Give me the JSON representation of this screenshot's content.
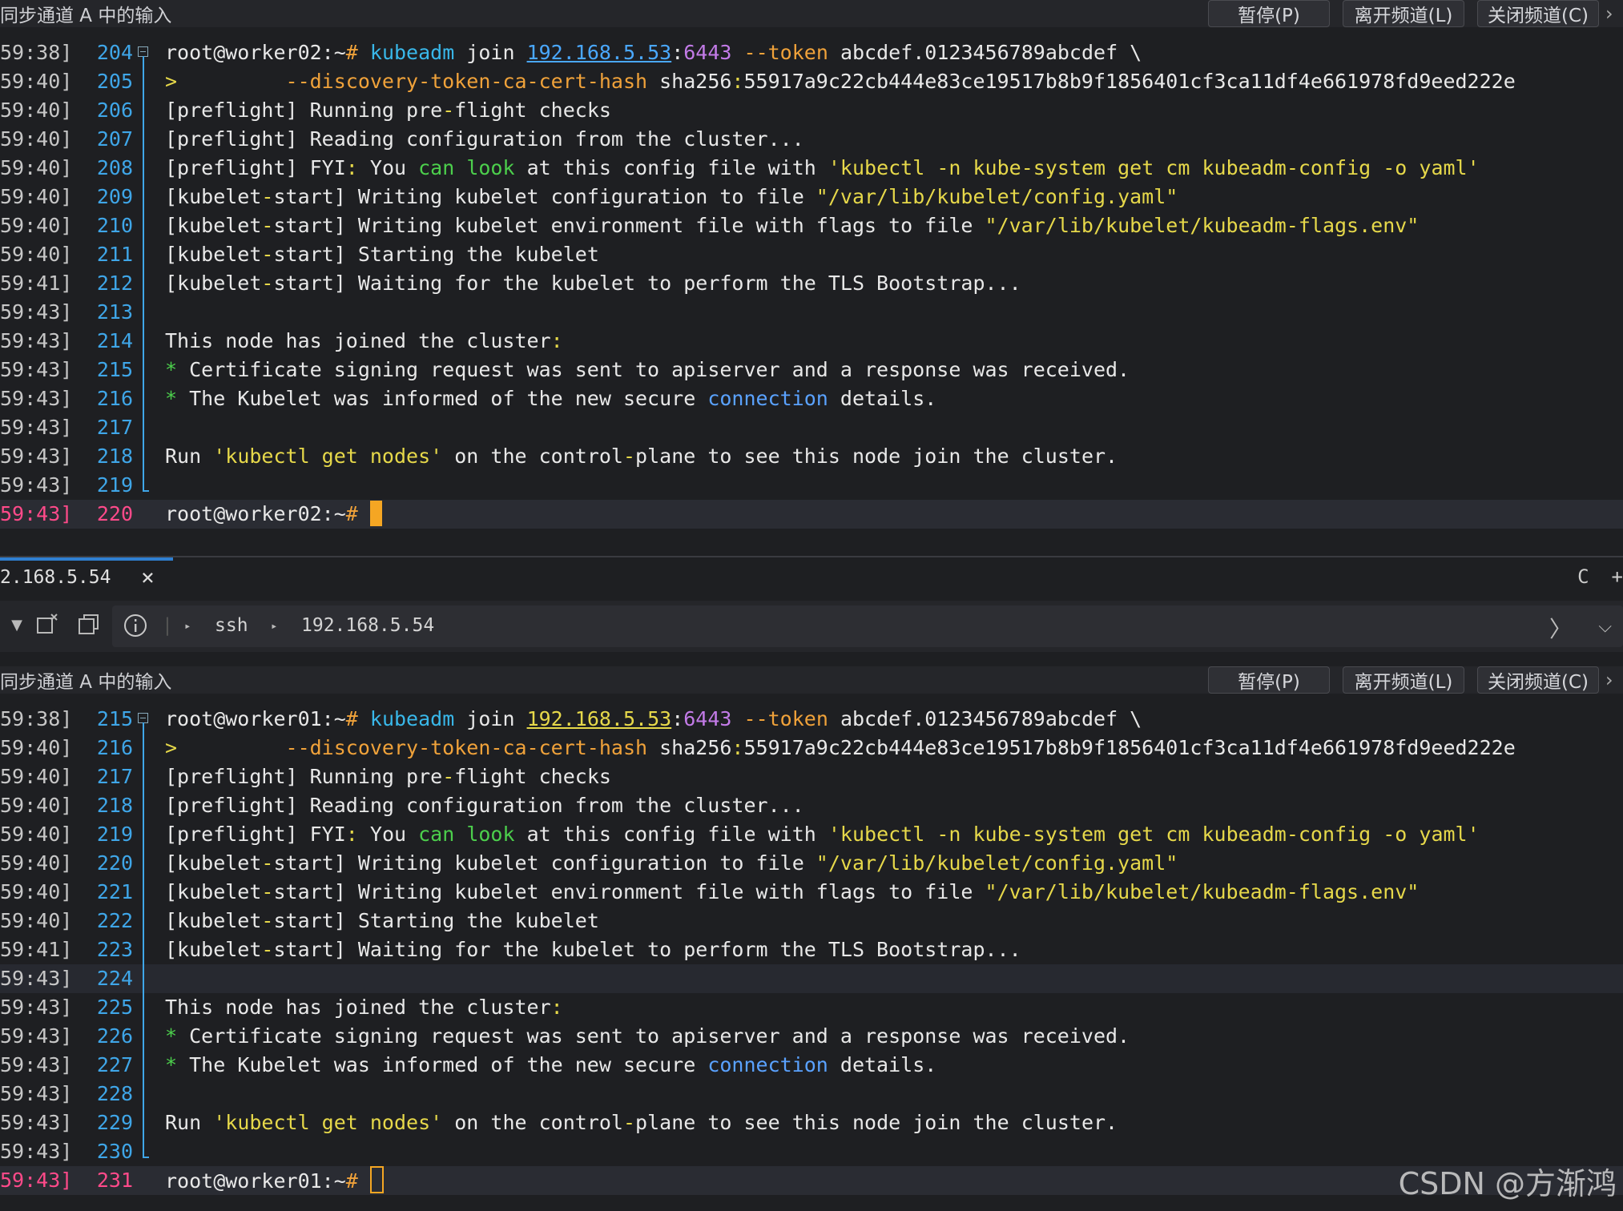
{
  "top_pane": {
    "bar": {
      "title": "同步通道 A 中的输入",
      "pause": "暂停(P)",
      "leave": "离开频道(L)",
      "close": "关闭频道(C)",
      "more": "›"
    },
    "lines": [
      {
        "ts": "59:38]",
        "ln": "204",
        "segs": [
          [
            "root@worker02:~",
            ""
          ],
          [
            "# ",
            "ora"
          ],
          [
            "kubeadm",
            "cyan"
          ],
          [
            " join ",
            ""
          ],
          [
            "192.168.5.53",
            "link"
          ],
          [
            ":",
            ""
          ],
          [
            "6443",
            "pur"
          ],
          [
            " --token",
            "ora"
          ],
          [
            " abcdef.0123456789abcdef \\",
            ""
          ]
        ]
      },
      {
        "ts": "59:40]",
        "ln": "205",
        "segs": [
          [
            "> ",
            "yel"
          ],
          [
            "        --discovery-token-ca-cert-hash",
            "ora"
          ],
          [
            " sha256",
            ""
          ],
          [
            ":",
            "yel"
          ],
          [
            "55917a9c22cb444e83ce19517b8b9f1856401cf3ca11df4e661978fd9eed222e",
            ""
          ]
        ]
      },
      {
        "ts": "59:40]",
        "ln": "206",
        "segs": [
          [
            "[preflight] Running pre",
            ""
          ],
          [
            "-",
            "yel"
          ],
          [
            "flight checks",
            ""
          ]
        ]
      },
      {
        "ts": "59:40]",
        "ln": "207",
        "segs": [
          [
            "[preflight] Reading configuration from the cluster...",
            ""
          ]
        ]
      },
      {
        "ts": "59:40]",
        "ln": "208",
        "segs": [
          [
            "[preflight] FYI",
            ""
          ],
          [
            ":",
            "yel"
          ],
          [
            " You ",
            ""
          ],
          [
            "can look",
            "grn"
          ],
          [
            " at this config file with ",
            ""
          ],
          [
            "'kubectl -n kube-system get cm kubeadm-config -o yaml'",
            "yel"
          ]
        ]
      },
      {
        "ts": "59:40]",
        "ln": "209",
        "segs": [
          [
            "[kubelet",
            ""
          ],
          [
            "-",
            "yel"
          ],
          [
            "start] Writing kubelet configuration to file ",
            ""
          ],
          [
            "\"/var/lib/kubelet/config.yaml\"",
            "yel"
          ]
        ]
      },
      {
        "ts": "59:40]",
        "ln": "210",
        "segs": [
          [
            "[kubelet",
            ""
          ],
          [
            "-",
            "yel"
          ],
          [
            "start] Writing kubelet environment file with flags to file ",
            ""
          ],
          [
            "\"/var/lib/kubelet/kubeadm-flags.env\"",
            "yel"
          ]
        ]
      },
      {
        "ts": "59:40]",
        "ln": "211",
        "segs": [
          [
            "[kubelet",
            ""
          ],
          [
            "-",
            "yel"
          ],
          [
            "start] Starting the kubelet",
            ""
          ]
        ]
      },
      {
        "ts": "59:41]",
        "ln": "212",
        "segs": [
          [
            "[kubelet",
            ""
          ],
          [
            "-",
            "yel"
          ],
          [
            "start] Waiting for the kubelet to perform the TLS Bootstrap...",
            ""
          ]
        ]
      },
      {
        "ts": "59:43]",
        "ln": "213",
        "segs": []
      },
      {
        "ts": "59:43]",
        "ln": "214",
        "segs": [
          [
            "This node has joined the cluster",
            ""
          ],
          [
            ":",
            "yel"
          ]
        ]
      },
      {
        "ts": "59:43]",
        "ln": "215",
        "segs": [
          [
            "* ",
            "grn"
          ],
          [
            "Certificate signing request was sent to apiserver and a response was received.",
            ""
          ]
        ]
      },
      {
        "ts": "59:43]",
        "ln": "216",
        "segs": [
          [
            "* ",
            "grn"
          ],
          [
            "The Kubelet was informed of the new secure ",
            ""
          ],
          [
            "connection",
            "blue"
          ],
          [
            " details.",
            ""
          ]
        ]
      },
      {
        "ts": "59:43]",
        "ln": "217",
        "segs": []
      },
      {
        "ts": "59:43]",
        "ln": "218",
        "segs": [
          [
            "Run ",
            ""
          ],
          [
            "'kubectl get nodes'",
            "yel"
          ],
          [
            " on the control",
            ""
          ],
          [
            "-",
            "yel"
          ],
          [
            "plane to see this node join the cluster.",
            ""
          ]
        ]
      },
      {
        "ts": "59:43]",
        "ln": "219",
        "segs": []
      },
      {
        "ts": "59:43]",
        "ln": "220",
        "segs": [
          [
            "root@worker02:~",
            ""
          ],
          [
            "# ",
            "ora"
          ]
        ],
        "current": true,
        "cursor": "block"
      }
    ]
  },
  "tab": {
    "label": "2.168.5.54",
    "close": "×",
    "right_c": "C",
    "right_plus": "+"
  },
  "toolbar": {
    "protocol": "ssh",
    "host": "192.168.5.54"
  },
  "bottom_pane": {
    "bar": {
      "title": "同步通道 A 中的输入",
      "pause": "暂停(P)",
      "leave": "离开频道(L)",
      "close": "关闭频道(C)",
      "more": "›"
    },
    "lines": [
      {
        "ts": "59:38]",
        "ln": "215",
        "segs": [
          [
            "root@worker01:~",
            ""
          ],
          [
            "# ",
            "ora"
          ],
          [
            "kubeadm",
            "cyan"
          ],
          [
            " join ",
            ""
          ],
          [
            "192.168.5.53",
            "link2"
          ],
          [
            ":",
            ""
          ],
          [
            "6443",
            "pur"
          ],
          [
            " --token",
            "ora"
          ],
          [
            " abcdef.0123456789abcdef \\",
            ""
          ]
        ]
      },
      {
        "ts": "59:40]",
        "ln": "216",
        "segs": [
          [
            "> ",
            "yel"
          ],
          [
            "        --discovery-token-ca-cert-hash",
            "ora"
          ],
          [
            " sha256",
            ""
          ],
          [
            ":",
            "yel"
          ],
          [
            "55917a9c22cb444e83ce19517b8b9f1856401cf3ca11df4e661978fd9eed222e",
            ""
          ]
        ]
      },
      {
        "ts": "59:40]",
        "ln": "217",
        "segs": [
          [
            "[preflight] Running pre",
            ""
          ],
          [
            "-",
            "yel"
          ],
          [
            "flight checks",
            ""
          ]
        ]
      },
      {
        "ts": "59:40]",
        "ln": "218",
        "segs": [
          [
            "[preflight] Reading configuration from the cluster...",
            ""
          ]
        ]
      },
      {
        "ts": "59:40]",
        "ln": "219",
        "segs": [
          [
            "[preflight] FYI",
            ""
          ],
          [
            ":",
            "yel"
          ],
          [
            " You ",
            ""
          ],
          [
            "can look",
            "grn"
          ],
          [
            " at this config file with ",
            ""
          ],
          [
            "'kubectl -n kube-system get cm kubeadm-config -o yaml'",
            "yel"
          ]
        ]
      },
      {
        "ts": "59:40]",
        "ln": "220",
        "segs": [
          [
            "[kubelet",
            ""
          ],
          [
            "-",
            "yel"
          ],
          [
            "start] Writing kubelet configuration to file ",
            ""
          ],
          [
            "\"/var/lib/kubelet/config.yaml\"",
            "yel"
          ]
        ]
      },
      {
        "ts": "59:40]",
        "ln": "221",
        "segs": [
          [
            "[kubelet",
            ""
          ],
          [
            "-",
            "yel"
          ],
          [
            "start] Writing kubelet environment file with flags to file ",
            ""
          ],
          [
            "\"/var/lib/kubelet/kubeadm-flags.env\"",
            "yel"
          ]
        ]
      },
      {
        "ts": "59:40]",
        "ln": "222",
        "segs": [
          [
            "[kubelet",
            ""
          ],
          [
            "-",
            "yel"
          ],
          [
            "start] Starting the kubelet",
            ""
          ]
        ]
      },
      {
        "ts": "59:41]",
        "ln": "223",
        "segs": [
          [
            "[kubelet",
            ""
          ],
          [
            "-",
            "yel"
          ],
          [
            "start] Waiting for the kubelet to perform the TLS Bootstrap...",
            ""
          ]
        ]
      },
      {
        "ts": "59:43]",
        "ln": "224",
        "segs": [],
        "highlight": true
      },
      {
        "ts": "59:43]",
        "ln": "225",
        "segs": [
          [
            "This node has joined the cluster",
            ""
          ],
          [
            ":",
            "yel"
          ]
        ]
      },
      {
        "ts": "59:43]",
        "ln": "226",
        "segs": [
          [
            "* ",
            "grn"
          ],
          [
            "Certificate signing request was sent to apiserver and a response was received.",
            ""
          ]
        ]
      },
      {
        "ts": "59:43]",
        "ln": "227",
        "segs": [
          [
            "* ",
            "grn"
          ],
          [
            "The Kubelet was informed of the new secure ",
            ""
          ],
          [
            "connection",
            "blue"
          ],
          [
            " details.",
            ""
          ]
        ]
      },
      {
        "ts": "59:43]",
        "ln": "228",
        "segs": []
      },
      {
        "ts": "59:43]",
        "ln": "229",
        "segs": [
          [
            "Run ",
            ""
          ],
          [
            "'kubectl get nodes'",
            "yel"
          ],
          [
            " on the control",
            ""
          ],
          [
            "-",
            "yel"
          ],
          [
            "plane to see this node join the cluster.",
            ""
          ]
        ]
      },
      {
        "ts": "59:43]",
        "ln": "230",
        "segs": []
      },
      {
        "ts": "59:43]",
        "ln": "231",
        "segs": [
          [
            "root@worker01:~",
            ""
          ],
          [
            "# ",
            "ora"
          ]
        ],
        "current": true,
        "cursor": "hollow"
      }
    ]
  },
  "watermark": "CSDN @方渐鸿"
}
